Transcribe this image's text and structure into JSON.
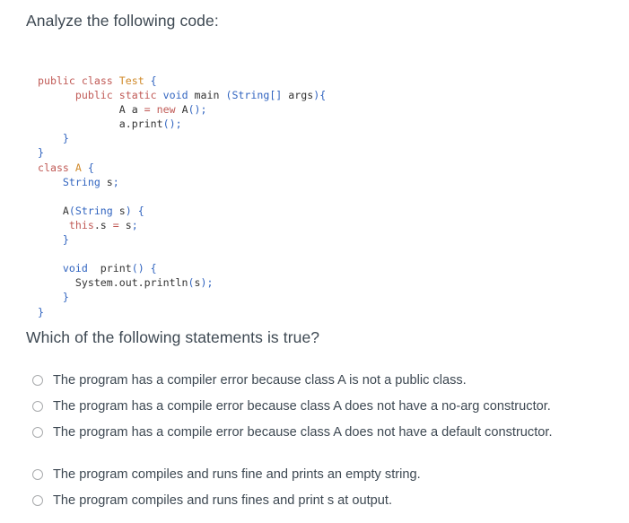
{
  "prompt": {
    "heading": "Analyze the following code:"
  },
  "code": {
    "language": "java",
    "lines": [
      [
        {
          "t": "public",
          "c": "k"
        },
        {
          "t": " ",
          "c": "d"
        },
        {
          "t": "class",
          "c": "k"
        },
        {
          "t": " ",
          "c": "d"
        },
        {
          "t": "Test",
          "c": "t"
        },
        {
          "t": " ",
          "c": "d"
        },
        {
          "t": "{",
          "c": "b"
        }
      ],
      [
        {
          "t": "      ",
          "c": "d"
        },
        {
          "t": "public",
          "c": "k"
        },
        {
          "t": " ",
          "c": "d"
        },
        {
          "t": "static",
          "c": "k"
        },
        {
          "t": " ",
          "c": "d"
        },
        {
          "t": "void",
          "c": "b"
        },
        {
          "t": " main ",
          "c": "d"
        },
        {
          "t": "(",
          "c": "b"
        },
        {
          "t": "String",
          "c": "b"
        },
        {
          "t": "[]",
          "c": "b"
        },
        {
          "t": " args",
          "c": "d"
        },
        {
          "t": ")",
          "c": "b"
        },
        {
          "t": "{",
          "c": "b"
        }
      ],
      [
        {
          "t": "             A a ",
          "c": "d"
        },
        {
          "t": "=",
          "c": "k"
        },
        {
          "t": " ",
          "c": "d"
        },
        {
          "t": "new",
          "c": "k"
        },
        {
          "t": " A",
          "c": "d"
        },
        {
          "t": "()",
          "c": "b"
        },
        {
          "t": ";",
          "c": "b"
        }
      ],
      [
        {
          "t": "             a.print",
          "c": "d"
        },
        {
          "t": "()",
          "c": "b"
        },
        {
          "t": ";",
          "c": "b"
        }
      ],
      [
        {
          "t": "    ",
          "c": "d"
        },
        {
          "t": "}",
          "c": "b"
        }
      ],
      [
        {
          "t": "}",
          "c": "b"
        }
      ],
      [
        {
          "t": "class",
          "c": "k"
        },
        {
          "t": " ",
          "c": "d"
        },
        {
          "t": "A",
          "c": "t"
        },
        {
          "t": " ",
          "c": "d"
        },
        {
          "t": "{",
          "c": "b"
        }
      ],
      [
        {
          "t": "    ",
          "c": "d"
        },
        {
          "t": "String",
          "c": "b"
        },
        {
          "t": " s",
          "c": "d"
        },
        {
          "t": ";",
          "c": "b"
        }
      ],
      [
        {
          "t": "",
          "c": "d"
        }
      ],
      [
        {
          "t": "    A",
          "c": "d"
        },
        {
          "t": "(",
          "c": "b"
        },
        {
          "t": "String",
          "c": "b"
        },
        {
          "t": " s",
          "c": "d"
        },
        {
          "t": ")",
          "c": "b"
        },
        {
          "t": " ",
          "c": "d"
        },
        {
          "t": "{",
          "c": "b"
        }
      ],
      [
        {
          "t": "     ",
          "c": "d"
        },
        {
          "t": "this",
          "c": "k"
        },
        {
          "t": ".s ",
          "c": "d"
        },
        {
          "t": "=",
          "c": "k"
        },
        {
          "t": " s",
          "c": "d"
        },
        {
          "t": ";",
          "c": "b"
        }
      ],
      [
        {
          "t": "    ",
          "c": "d"
        },
        {
          "t": "}",
          "c": "b"
        }
      ],
      [
        {
          "t": "",
          "c": "d"
        }
      ],
      [
        {
          "t": "    ",
          "c": "d"
        },
        {
          "t": "void",
          "c": "b"
        },
        {
          "t": "  print",
          "c": "d"
        },
        {
          "t": "()",
          "c": "b"
        },
        {
          "t": " ",
          "c": "d"
        },
        {
          "t": "{",
          "c": "b"
        }
      ],
      [
        {
          "t": "      System.out.println",
          "c": "d"
        },
        {
          "t": "(",
          "c": "b"
        },
        {
          "t": "s",
          "c": "d"
        },
        {
          "t": ")",
          "c": "b"
        },
        {
          "t": ";",
          "c": "b"
        }
      ],
      [
        {
          "t": "    ",
          "c": "d"
        },
        {
          "t": "}",
          "c": "b"
        }
      ],
      [
        {
          "t": "}",
          "c": "b"
        }
      ]
    ]
  },
  "question": {
    "heading": "Which of the following statements is true?",
    "options": [
      {
        "label": "The program has a compiler error because class A is not a public class.",
        "selected": false,
        "gap_before": false
      },
      {
        "label": "The program has a compile error because class A does not have a no-arg constructor.",
        "selected": false,
        "gap_before": false
      },
      {
        "label": "The program has a compile error because class A does not have a default constructor.",
        "selected": false,
        "gap_before": false
      },
      {
        "label": "The program compiles and runs fine and prints an empty string.",
        "selected": false,
        "gap_before": true
      },
      {
        "label": "The program compiles and runs fines and print s at output.",
        "selected": false,
        "gap_before": false
      }
    ]
  },
  "colors": {
    "keyword": "#c05a56",
    "type_name": "#d08a2a",
    "blue_token": "#3265c0",
    "default_text": "#333333",
    "heading_text": "#3d4852",
    "radio_border": "#a9abad",
    "background": "#ffffff"
  }
}
